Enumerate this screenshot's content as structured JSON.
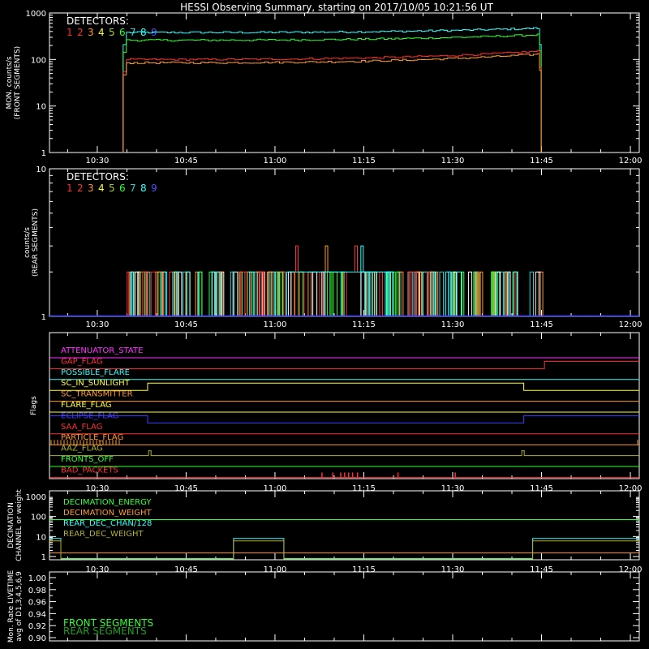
{
  "title": "HESSI Observing Summary, starting on 2017/10/05 10:21:56 UT",
  "time_axis": {
    "start": "10:21:56",
    "end": "12:01:30",
    "tick_labels": [
      "10:30",
      "10:45",
      "11:00",
      "11:15",
      "11:30",
      "11:45",
      "12:00"
    ]
  },
  "detector_colors": [
    "#ff2a2a",
    "#ff3030",
    "#ff9a30",
    "#ffff30",
    "#a0d030",
    "#30ff30",
    "#30d0d0",
    "#30ffff",
    "#5050ff"
  ],
  "chart_data": [
    {
      "type": "line",
      "name": "front",
      "ylabel": "MON. counts/s\n(FRONT SEGMENTS)",
      "yscale": "log",
      "ylim": [
        1,
        1000
      ],
      "ytick_labels": [
        "1",
        "10",
        "100",
        "1000"
      ],
      "legend_title": "DETECTORS:",
      "legend_numbers": [
        "1",
        "2",
        "3",
        "4",
        "5",
        "6",
        "7",
        "8",
        "9"
      ],
      "active_interval": [
        "10:34:30",
        "11:44:40"
      ],
      "series": [
        {
          "color": "#30ffff",
          "start": 380,
          "end": 470
        },
        {
          "color": "#30ff30",
          "start": 260,
          "end": 340
        },
        {
          "color": "#ff3030",
          "start": 100,
          "end": 150
        },
        {
          "color": "#ff9a30",
          "start": 85,
          "end": 130
        }
      ]
    },
    {
      "type": "line",
      "name": "rear",
      "ylabel": "counts/s\n(REAR SEGMENTS)",
      "yscale": "log",
      "ylim": [
        1,
        10
      ],
      "ytick_labels": [
        "1",
        "10"
      ],
      "legend_title": "DETECTORS:",
      "legend_numbers": [
        "1",
        "2",
        "3",
        "4",
        "5",
        "6",
        "7",
        "8",
        "9"
      ],
      "spike_level": 2,
      "high_level": 3
    },
    {
      "type": "line",
      "name": "flags",
      "ylabel": "Flags",
      "flags": [
        {
          "label": "ATTENUATOR_STATE",
          "color": "#ff30ff"
        },
        {
          "label": "GAP_FLAG",
          "color": "#ff3030"
        },
        {
          "label": "POSSIBLE_FLARE",
          "color": "#30ffff"
        },
        {
          "label": "SC_IN_SUNLIGHT",
          "color": "#ffff30"
        },
        {
          "label": "SC_TRANSMITTER",
          "color": "#ff9a30"
        },
        {
          "label": "FLARE_FLAG",
          "color": "#ffff30"
        },
        {
          "label": "ECLIPSE_FLAG",
          "color": "#4040ff"
        },
        {
          "label": "SAA_FLAG",
          "color": "#ff3030"
        },
        {
          "label": "PARTICLE_FLAG",
          "color": "#ff9a30"
        },
        {
          "label": "AAZ_FLAG",
          "color": "#b0b030"
        },
        {
          "label": "FRONTS_OFF",
          "color": "#30ff30"
        },
        {
          "label": "BAD_PACKETS",
          "color": "#ff3030"
        }
      ]
    },
    {
      "type": "line",
      "name": "decimation",
      "ylabel": "DECIMATION\nCHANNEL or weight",
      "yscale": "log",
      "ytick_labels": [
        "1",
        "10",
        "100",
        "1000"
      ],
      "series": [
        {
          "name": "DECIMATION_ENERGY",
          "color": "#30ff30"
        },
        {
          "name": "DECIMATION_WEIGHT",
          "color": "#ff9a30"
        },
        {
          "name": "REAR_DEC_CHAN/128",
          "color": "#30ffff"
        },
        {
          "name": "REAR_DEC_WEIGHT",
          "color": "#b0b030"
        }
      ]
    },
    {
      "type": "line",
      "name": "livetime",
      "ylabel": "Mon. Rate LIVETIME\navg of D1,3,4,5,6,9",
      "ylim": [
        0.9,
        1.0
      ],
      "ytick_labels": [
        "0.90",
        "0.92",
        "0.94",
        "0.96",
        "0.98",
        "1.00"
      ],
      "series": [
        {
          "name": "FRONT SEGMENTS",
          "color": "#30ff30"
        },
        {
          "name": "REAR SEGMENTS",
          "color": "#20a020"
        }
      ]
    }
  ]
}
